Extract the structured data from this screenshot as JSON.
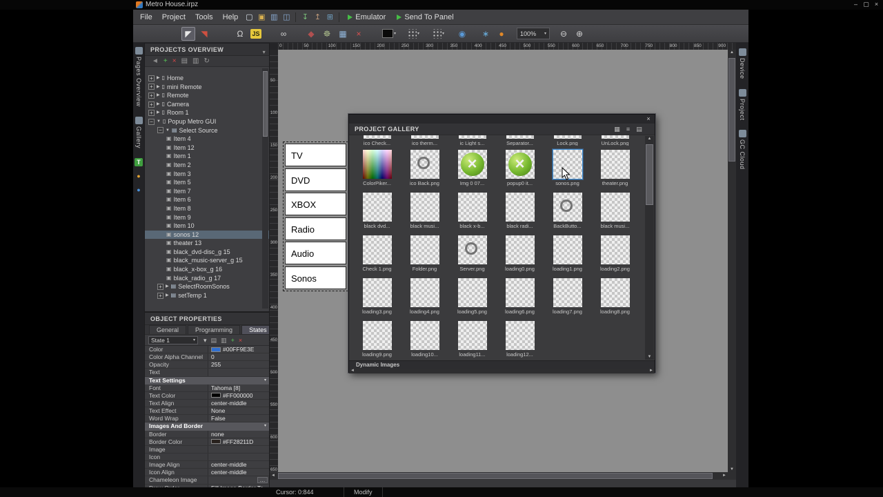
{
  "window": {
    "title": "Metro House.irpz",
    "controls": {
      "minimize": "–",
      "maximize": "▢",
      "close": "×"
    }
  },
  "menubar": {
    "menus": [
      "File",
      "Project",
      "Tools",
      "Help"
    ],
    "icons": [
      {
        "name": "new-page-icon",
        "glyph": "▢",
        "color": "#d8e0e8"
      },
      {
        "name": "open-project-icon",
        "glyph": "▣",
        "color": "#d8b050"
      },
      {
        "name": "save-icon",
        "glyph": "▥",
        "color": "#88a8d0"
      },
      {
        "name": "save-all-icon",
        "glyph": "◫",
        "color": "#88a8d0"
      },
      {
        "sep": true
      },
      {
        "name": "import-icon",
        "glyph": "↧",
        "color": "#7ac07a"
      },
      {
        "name": "export-icon",
        "glyph": "↥",
        "color": "#c09a7a"
      },
      {
        "name": "panel-layout-icon",
        "glyph": "⊞",
        "color": "#6f9fc0"
      },
      {
        "sep": true
      }
    ],
    "run_buttons": [
      {
        "name": "emulator-button",
        "label": "Emulator"
      },
      {
        "name": "send-to-panel-button",
        "label": "Send To Panel"
      }
    ]
  },
  "toolbar": {
    "zoom_value": "100%",
    "tools": [
      {
        "kind": "tool",
        "name": "select-tool",
        "glyph": "◤",
        "color": "#e8e8e8",
        "active": true
      },
      {
        "kind": "tool",
        "name": "hotspot-tool",
        "glyph": "◥",
        "color": "#cf5040"
      },
      {
        "kind": "gap",
        "w": 26
      },
      {
        "kind": "tool",
        "name": "macro-tool",
        "glyph": "Ω",
        "color": "#d8d8d8"
      },
      {
        "kind": "js",
        "name": "script-tool",
        "glyph": "JS"
      },
      {
        "kind": "gap",
        "w": 14
      },
      {
        "kind": "tool",
        "name": "link-tool",
        "glyph": "∞",
        "color": "#cfcfcf"
      },
      {
        "kind": "gap",
        "w": 14
      },
      {
        "kind": "tool",
        "name": "paint-tool",
        "glyph": "◆",
        "color": "#b05050"
      },
      {
        "kind": "tool",
        "name": "gear-tool",
        "glyph": "☸",
        "color": "#a8b888"
      },
      {
        "kind": "tool",
        "name": "grid-tool",
        "glyph": "▦",
        "color": "#90b4d8"
      },
      {
        "kind": "tool",
        "name": "delete-tool",
        "glyph": "×",
        "color": "#d85050"
      },
      {
        "kind": "gap",
        "w": 18
      },
      {
        "kind": "swatch",
        "name": "color-picker-dropdown"
      },
      {
        "kind": "gap",
        "w": 10
      },
      {
        "kind": "dots",
        "name": "align-objects-dropdown"
      },
      {
        "kind": "gap",
        "w": 12
      },
      {
        "kind": "dots",
        "name": "distribute-objects-dropdown"
      },
      {
        "kind": "gap",
        "w": 10
      },
      {
        "kind": "tool",
        "name": "snap-tool",
        "glyph": "◉",
        "color": "#5a9ad8"
      },
      {
        "kind": "gap",
        "w": 8
      },
      {
        "kind": "tool",
        "name": "effects-tool",
        "glyph": "∗",
        "color": "#6ab0e0"
      },
      {
        "kind": "tool",
        "name": "theme-tool",
        "glyph": "●",
        "color": "#e08828"
      },
      {
        "kind": "gap",
        "w": 6
      },
      {
        "kind": "zoom",
        "name": "zoom-level-select"
      },
      {
        "kind": "gap",
        "w": 4
      },
      {
        "kind": "tool",
        "name": "zoom-out-tool",
        "glyph": "⊖",
        "color": "#d0d0d0"
      },
      {
        "kind": "tool",
        "name": "zoom-in-tool",
        "glyph": "⊕",
        "color": "#d0d0d0"
      }
    ]
  },
  "left_dock": {
    "tabs": [
      {
        "name": "pages-overview-tab",
        "icon": "pages-icon",
        "label": "Pages Overview"
      },
      {
        "name": "gallery-tab",
        "icon": "gallery-icon",
        "label": "Gallery"
      }
    ],
    "mini_tabs": [
      {
        "name": "templates-tab",
        "glyph": "T",
        "bg": "#3f9e3f",
        "color": "#ffffff"
      },
      {
        "name": "sounds-tab",
        "glyph": "●",
        "color": "#e0a030"
      },
      {
        "name": "cloud-tab",
        "glyph": "●",
        "color": "#4a90d8"
      }
    ]
  },
  "right_dock": {
    "tabs": [
      {
        "name": "device-tab",
        "icon": "device-icon",
        "label": "Device"
      },
      {
        "name": "project-tab",
        "icon": "project-icon",
        "label": "Project"
      },
      {
        "name": "gc-cloud-tab",
        "icon": "cloud-icon",
        "label": "GC Cloud"
      }
    ]
  },
  "projects_panel": {
    "title": "PROJECTS OVERVIEW",
    "toolbar_icons": [
      {
        "name": "back-icon",
        "glyph": "◄",
        "color": "#8a8a8a"
      },
      {
        "name": "add-page-icon",
        "glyph": "+",
        "color": "#58c858"
      },
      {
        "name": "delete-page-icon",
        "glyph": "×",
        "color": "#d84848"
      },
      {
        "name": "expand-all-icon",
        "glyph": "▤",
        "color": "#9a9a9a"
      },
      {
        "name": "collapse-all-icon",
        "glyph": "▥",
        "color": "#9a9a9a"
      },
      {
        "name": "refresh-icon",
        "glyph": "↻",
        "color": "#9a9a9a"
      }
    ],
    "header_icon": "▾",
    "tree": [
      {
        "label": "Home",
        "depth": 0,
        "expander": "collapsed",
        "icon": "page"
      },
      {
        "label": "mini Remote",
        "depth": 0,
        "expander": "collapsed",
        "icon": "page"
      },
      {
        "label": "Remote",
        "depth": 0,
        "expander": "collapsed",
        "icon": "page"
      },
      {
        "label": "Camera",
        "depth": 0,
        "expander": "collapsed",
        "icon": "page"
      },
      {
        "label": "Room 1",
        "depth": 0,
        "expander": "collapsed",
        "icon": "page"
      },
      {
        "label": "Popup Metro GUI",
        "depth": 0,
        "expander": "expanded",
        "icon": "page"
      },
      {
        "label": "Select Source",
        "depth": 1,
        "expander": "expanded",
        "icon": "group"
      },
      {
        "label": "Item 4",
        "depth": 2,
        "icon": "item"
      },
      {
        "label": "Item 12",
        "depth": 2,
        "icon": "item"
      },
      {
        "label": "Item 1",
        "depth": 2,
        "icon": "item"
      },
      {
        "label": "Item 2",
        "depth": 2,
        "icon": "item"
      },
      {
        "label": "Item 3",
        "depth": 2,
        "icon": "item"
      },
      {
        "label": "Item 5",
        "depth": 2,
        "icon": "item"
      },
      {
        "label": "Item 7",
        "depth": 2,
        "icon": "item"
      },
      {
        "label": "Item 6",
        "depth": 2,
        "icon": "item"
      },
      {
        "label": "Item 8",
        "depth": 2,
        "icon": "item"
      },
      {
        "label": "Item 9",
        "depth": 2,
        "icon": "item"
      },
      {
        "label": "Item 10",
        "depth": 2,
        "icon": "item"
      },
      {
        "label": "sonos 12",
        "depth": 2,
        "icon": "item",
        "selected": true
      },
      {
        "label": "theater 13",
        "depth": 2,
        "icon": "item"
      },
      {
        "label": "black_dvd-disc_g 15",
        "depth": 2,
        "icon": "item"
      },
      {
        "label": "black_music-server_g 15",
        "depth": 2,
        "icon": "item"
      },
      {
        "label": "black_x-box_g 16",
        "depth": 2,
        "icon": "item"
      },
      {
        "label": "black_radio_g 17",
        "depth": 2,
        "icon": "item"
      },
      {
        "label": "SelectRoomSonos",
        "depth": 1,
        "expander": "collapsed",
        "icon": "group"
      },
      {
        "label": "setTemp 1",
        "depth": 1,
        "expander": "collapsed",
        "icon": "group"
      }
    ]
  },
  "properties_panel": {
    "title": "OBJECT PROPERTIES",
    "tabs": [
      "General",
      "Programming",
      "States"
    ],
    "active_tab": "States",
    "state_selector": {
      "value": "State 1"
    },
    "state_icons": [
      {
        "name": "state-menu-icon",
        "glyph": "▾",
        "color": "#c0c0c0"
      },
      {
        "name": "copy-state-icon",
        "glyph": "▤",
        "color": "#a0a0a0"
      },
      {
        "name": "paste-state-icon",
        "glyph": "▥",
        "color": "#a0a0a0"
      },
      {
        "name": "add-state-icon",
        "glyph": "+",
        "color": "#58c858"
      },
      {
        "name": "delete-state-icon",
        "glyph": "×",
        "color": "#d84848"
      }
    ],
    "rows": [
      {
        "name": "Color",
        "value": "#00FF9E3E",
        "swatch": "#2f6fd0"
      },
      {
        "name": "Color Alpha Channel",
        "value": "0"
      },
      {
        "name": "Opacity",
        "value": "255"
      },
      {
        "name": "Text",
        "value": ""
      },
      {
        "section": "Text Settings"
      },
      {
        "name": "Font",
        "value": "Tahoma [8]"
      },
      {
        "name": "Text Color",
        "value": "#FF000000",
        "swatch": "#000000"
      },
      {
        "name": "Text Align",
        "value": "center-middle"
      },
      {
        "name": "Text Effect",
        "value": "None"
      },
      {
        "name": "Word Wrap",
        "value": "False"
      },
      {
        "section": "Images And Border"
      },
      {
        "name": "Border",
        "value": "none"
      },
      {
        "name": "Border Color",
        "value": "#FF28211D",
        "swatch": "#28211d"
      },
      {
        "name": "Image",
        "value": ""
      },
      {
        "name": "Icon",
        "value": ""
      },
      {
        "name": "Image Align",
        "value": "center-middle"
      },
      {
        "name": "Icon Align",
        "value": "center-middle"
      },
      {
        "name": "Chameleon Image",
        "value": "",
        "ellipsis": true
      },
      {
        "name": "Draw Order",
        "value": "Fill Image Border Te..."
      }
    ]
  },
  "canvas": {
    "h_ruler": [
      "0",
      "50",
      "100",
      "150",
      "200",
      "250",
      "300",
      "350",
      "400",
      "450",
      "500",
      "550",
      "600",
      "650",
      "700",
      "750",
      "800",
      "850",
      "900"
    ],
    "v_ruler": [
      "50",
      "100",
      "150",
      "200",
      "250",
      "300",
      "350",
      "400",
      "450",
      "500",
      "550",
      "600",
      "650"
    ],
    "source_menu": {
      "items": [
        "TV",
        "DVD",
        "XBOX",
        "Radio",
        "Audio",
        "Sonos"
      ]
    }
  },
  "gallery_window": {
    "title": "PROJECT GALLERY",
    "close_glyph": "×",
    "view_icons": [
      {
        "name": "view-thumbnails-icon",
        "glyph": "▦"
      },
      {
        "name": "view-list-icon",
        "glyph": "≡"
      },
      {
        "name": "view-details-icon",
        "glyph": "▤"
      }
    ],
    "partial_row_labels": [
      "ico Check...",
      "ico therm...",
      "ic Light s...",
      "Separator...",
      "Lock.png",
      "UnLock.png"
    ],
    "rows": [
      [
        {
          "label": "ColorPiker...",
          "thumb": "rainbow"
        },
        {
          "label": "ico Back.png",
          "thumb": "circle"
        },
        {
          "label": "Img 0 07...",
          "thumb": "xbox"
        },
        {
          "label": "popup0 it...",
          "thumb": "xbox"
        },
        {
          "label": "sonos.png",
          "thumb": "checker",
          "selected": true
        },
        {
          "label": "theater.png",
          "thumb": "checker"
        }
      ],
      [
        {
          "label": "black dvd...",
          "thumb": "checker"
        },
        {
          "label": "black musi...",
          "thumb": "checker"
        },
        {
          "label": "black x-b...",
          "thumb": "checker"
        },
        {
          "label": "black radi...",
          "thumb": "checker"
        },
        {
          "label": "BackButto...",
          "thumb": "circle"
        },
        {
          "label": "black musi...",
          "thumb": "checker"
        }
      ],
      [
        {
          "label": "Check 1.png",
          "thumb": "checker"
        },
        {
          "label": "Folder.png",
          "thumb": "checker"
        },
        {
          "label": "Server.png",
          "thumb": "circle"
        },
        {
          "label": "loading0.png",
          "thumb": "checker"
        },
        {
          "label": "loading1.png",
          "thumb": "checker"
        },
        {
          "label": "loading2.png",
          "thumb": "checker"
        }
      ],
      [
        {
          "label": "loading3.png",
          "thumb": "checker"
        },
        {
          "label": "loading4.png",
          "thumb": "checker"
        },
        {
          "label": "loading5.png",
          "thumb": "checker"
        },
        {
          "label": "loading6.png",
          "thumb": "checker"
        },
        {
          "label": "loading7.png",
          "thumb": "checker"
        },
        {
          "label": "loading8.png",
          "thumb": "checker"
        }
      ],
      [
        {
          "label": "loading9.png",
          "thumb": "checker"
        },
        {
          "label": "loading10...",
          "thumb": "checker"
        },
        {
          "label": "loading11...",
          "thumb": "checker"
        },
        {
          "label": "loading12...",
          "thumb": "checker"
        }
      ]
    ],
    "footer": "Dynamic Images"
  },
  "status_bar": {
    "cursor": "Cursor: 0:844",
    "mode": "Modify"
  },
  "colors": {
    "selection": "#596876",
    "gallery_selection": "#3f8fd6",
    "xbox_green": "#76b82f",
    "canvas_gray": "#8e8e8e"
  }
}
